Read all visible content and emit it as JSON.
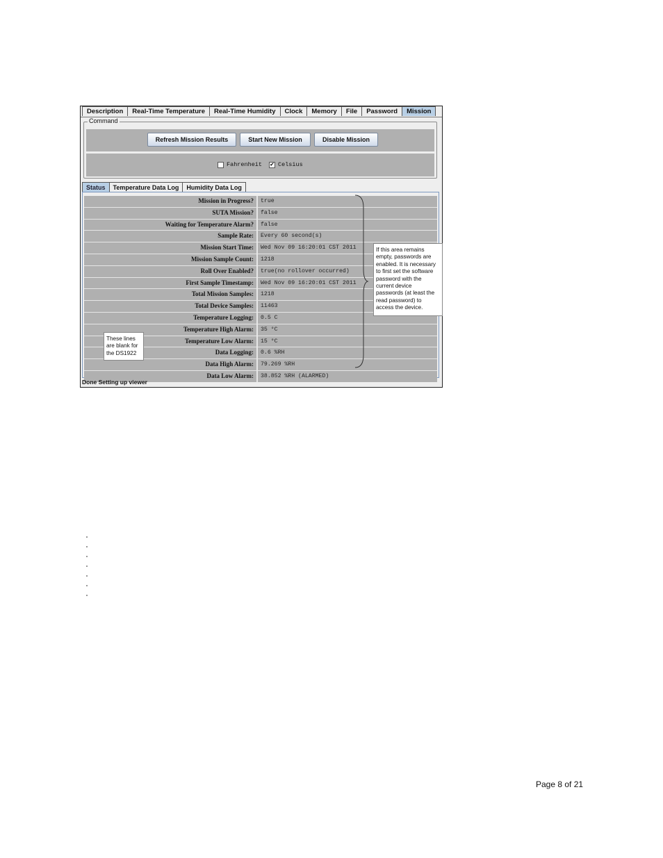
{
  "tabs": [
    "Description",
    "Real-Time Temperature",
    "Real-Time Humidity",
    "Clock",
    "Memory",
    "File",
    "Password",
    "Mission"
  ],
  "active_tab": "Mission",
  "command": {
    "legend": "Command",
    "refresh_label": "Refresh Mission Results",
    "start_label": "Start New Mission",
    "disable_label": "Disable Mission"
  },
  "units": {
    "fahrenheit_label": "Fahrenheit",
    "fahrenheit_checked": false,
    "celsius_label": "Celsius",
    "celsius_checked": true,
    "check_glyph": "✔"
  },
  "subtabs": [
    "Status",
    "Temperature Data Log",
    "Humidity Data Log"
  ],
  "active_subtab": "Status",
  "status_rows": [
    {
      "label": "Mission in Progress?",
      "value": "true"
    },
    {
      "label": "SUTA Mission?",
      "value": "false"
    },
    {
      "label": "Waiting for Temperature Alarm?",
      "value": "false"
    },
    {
      "label": "Sample Rate:",
      "value": "Every 60 second(s)"
    },
    {
      "label": "Mission Start Time:",
      "value": "Wed Nov 09 16:20:01 CST 2011"
    },
    {
      "label": "Mission Sample Count:",
      "value": "1218"
    },
    {
      "label": "Roll Over Enabled?",
      "value": "true(no rollover occurred)"
    },
    {
      "label": "First Sample Timestamp:",
      "value": "Wed Nov 09 16:20:01 CST 2011"
    },
    {
      "label": "Total Mission Samples:",
      "value": "1218"
    },
    {
      "label": "Total Device Samples:",
      "value": "11463"
    },
    {
      "label": "Temperature Logging:",
      "value": "0.5 C"
    },
    {
      "label": "Temperature High Alarm:",
      "value": "35 °C"
    },
    {
      "label": "Temperature Low Alarm:",
      "value": "15 °C"
    },
    {
      "label": "Data Logging:",
      "value": "0.6 %RH"
    },
    {
      "label": "Data High Alarm:",
      "value": "79.269 %RH"
    },
    {
      "label": "Data Low Alarm:",
      "value": "38.852 %RH (ALARMED)"
    }
  ],
  "status_bar": "Done Setting up viewer",
  "callout_right": "If this area remains empty, passwords are enabled. It is necessary to first set the software password with the current device passwords (at least the read password) to access the device.",
  "callout_left": "These lines are blank for the DS1922",
  "bullet_count": 7,
  "page_number": "Page 8 of 21"
}
